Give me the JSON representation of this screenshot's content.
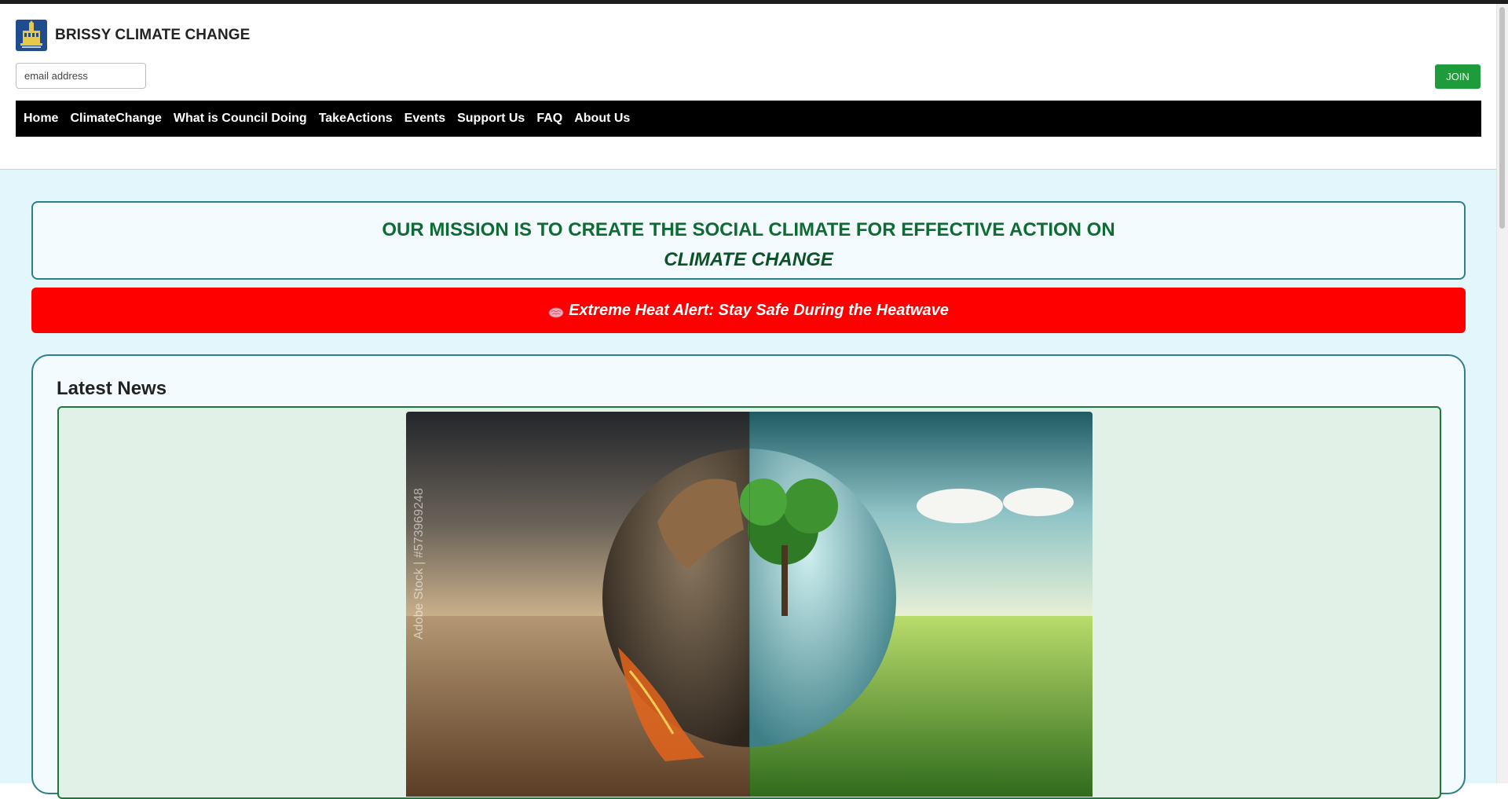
{
  "header": {
    "brand_title": "BRISSY CLIMATE CHANGE",
    "email_placeholder": "email address",
    "join_label": "JOIN"
  },
  "nav": {
    "items": [
      {
        "label": "Home"
      },
      {
        "label": "ClimateChange"
      },
      {
        "label": "What is Council Doing"
      },
      {
        "label": "TakeActions"
      },
      {
        "label": "Events"
      },
      {
        "label": "Support Us"
      },
      {
        "label": "FAQ"
      },
      {
        "label": "About Us"
      }
    ]
  },
  "mission": {
    "line1": "OUR MISSION IS TO CREATE THE SOCIAL CLIMATE FOR EFFECTIVE ACTION ON",
    "line2": "CLIMATE CHANGE"
  },
  "alert": {
    "icon": "brain-icon",
    "text": "Extreme Heat Alert: Stay Safe During the Heatwave"
  },
  "news": {
    "heading": "Latest News",
    "image_watermark": "Adobe Stock | #573969248"
  },
  "colors": {
    "join_button": "#1e9b3a",
    "nav_background": "#000000",
    "alert_background": "#ff0000",
    "mission_text": "#0e6b32",
    "content_background": "#e3f6fc"
  }
}
